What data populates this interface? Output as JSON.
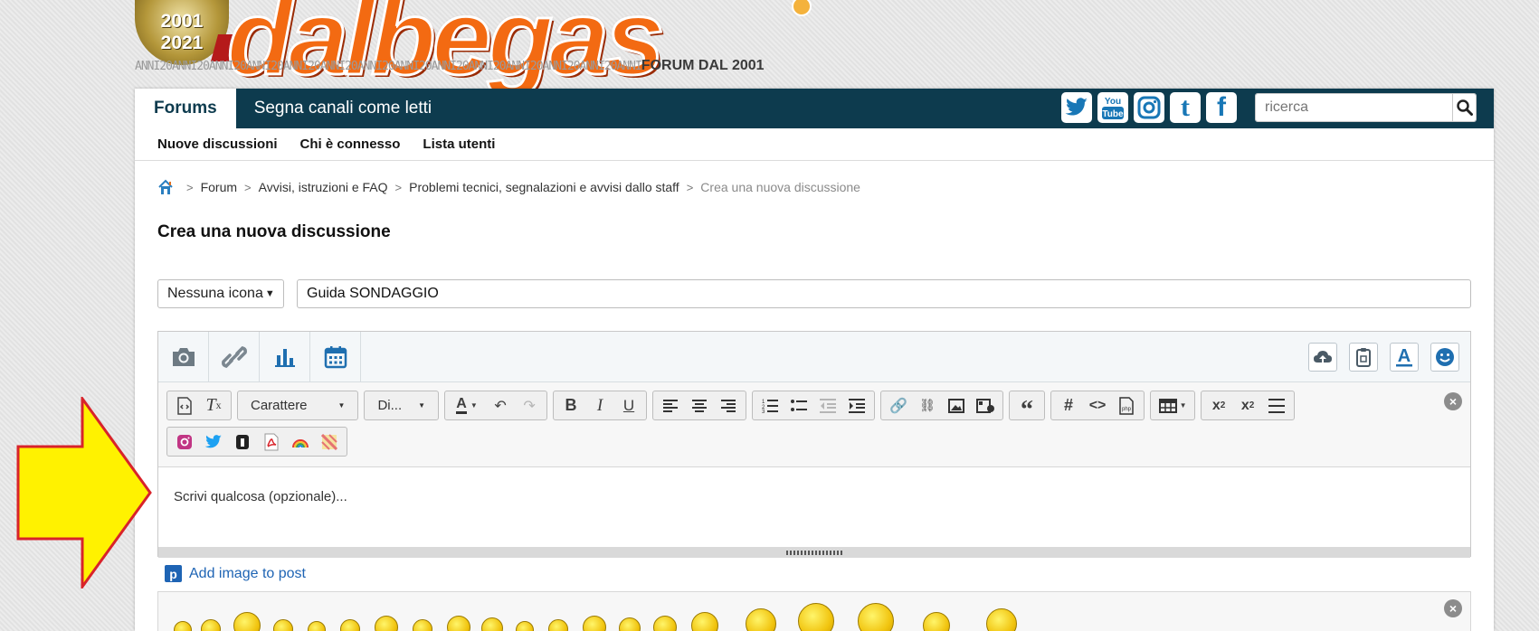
{
  "logo": {
    "years": [
      "2001",
      "2021"
    ],
    "wordmark": "dalbegas",
    "strip_ghost": "ANNI20ANNI20ANNI20ANNI20ANNI20ANNI20ANNI20ANNI20ANNI20ANNI20ANNI20ANNI20ANNI20ANNI",
    "strip_tag": "FORUM DAL 2001"
  },
  "navbar": {
    "active_tab": "Forums",
    "tabs": [
      "Segna canali come letti"
    ],
    "social": [
      "twitter-icon",
      "youtube-icon",
      "instagram-icon",
      "tumblr-icon",
      "facebook-icon"
    ],
    "social_labels": {
      "youtube": "You Tube",
      "tumblr": "t",
      "facebook": "f"
    },
    "search_placeholder": "ricerca"
  },
  "subnav": {
    "links": [
      "Nuove discussioni",
      "Chi è connesso",
      "Lista utenti"
    ]
  },
  "breadcrumb": {
    "items": [
      "Forum",
      "Avvisi, istruzioni e FAQ",
      "Problemi tecnici, segnalazioni e avvisi dallo staff"
    ],
    "current": "Crea una nuova discussione"
  },
  "page_title": "Crea una nuova discussione",
  "form": {
    "icon_select": "Nessuna icona",
    "title_value": "Guida SONDAGGIO",
    "message_placeholder": "Scrivi qualcosa (opzionale)..."
  },
  "toolbar": {
    "font_label": "Carattere",
    "size_label": "Di...",
    "close": "×"
  },
  "add_image_label": "Add image to post",
  "smilies_close": "×",
  "colors": {
    "navbar": "#0d3b4e",
    "link": "#1e64b4",
    "arrow_fill": "#fff200",
    "arrow_stroke": "#d8232a"
  }
}
